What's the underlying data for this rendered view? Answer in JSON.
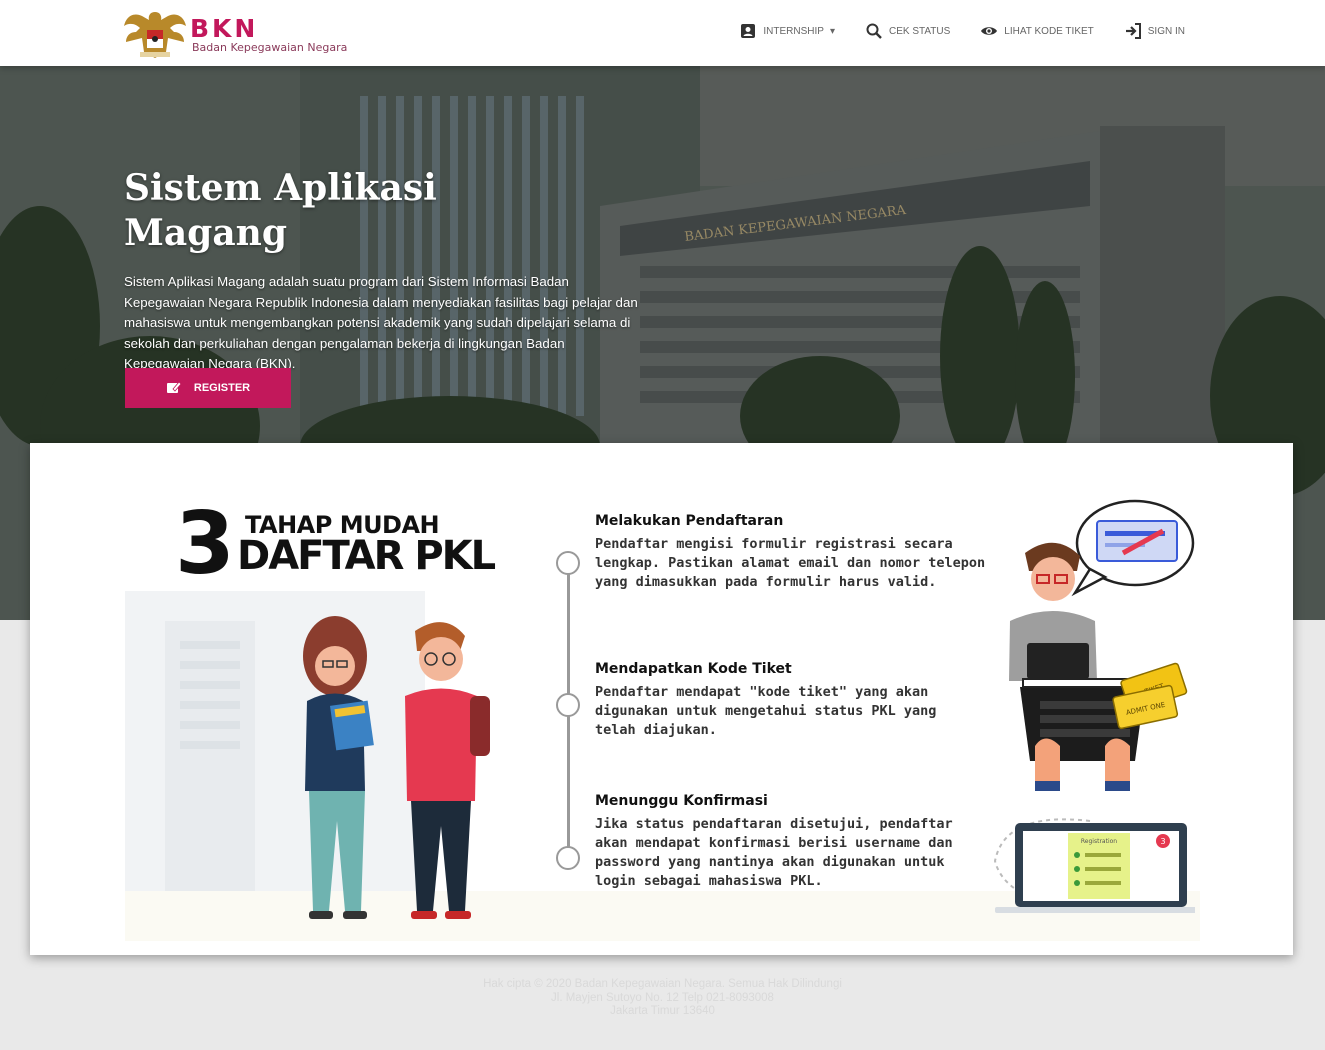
{
  "brand": {
    "name": "BKN",
    "subtitle": "Badan Kepegawaian Negara"
  },
  "nav": {
    "items": [
      {
        "label": "INTERNSHIP",
        "icon": "id-card-icon",
        "dropdown": true
      },
      {
        "label": "CEK STATUS",
        "icon": "search-icon"
      },
      {
        "label": "LIHAT KODE TIKET",
        "icon": "eye-icon"
      },
      {
        "label": "SIGN IN",
        "icon": "sign-in-icon"
      }
    ]
  },
  "hero": {
    "title_line1": "Sistem Aplikasi",
    "title_line2": "Magang",
    "description": "Sistem Aplikasi Magang adalah suatu program dari Sistem Informasi Badan Kepegawaian Negara Republik Indonesia dalam menyediakan fasilitas bagi pelajar dan mahasiswa untuk mengembangkan potensi akademik yang sudah dipelajari selama di sekolah dan perkuliahan dengan pengalaman bekerja di lingkungan Badan Kepegawaian Negara (BKN).",
    "building_sign": "BADAN KEPEGAWAIAN NEGARA",
    "register_label": "REGISTER"
  },
  "infographic": {
    "number": "3",
    "line1": "TAHAP MUDAH",
    "line2": "DAFTAR PKL",
    "steps": [
      {
        "title": "Melakukan Pendaftaran",
        "text": "Pendaftar mengisi formulir registrasi secara lengkap. Pastikan alamat email dan nomor telepon yang dimasukkan pada formulir harus valid."
      },
      {
        "title": "Mendapatkan Kode Tiket",
        "text": "Pendaftar mendapat \"kode tiket\" yang akan digunakan untuk mengetahui status PKL yang telah diajukan."
      },
      {
        "title": "Menunggu  Konfirmasi",
        "text": "Jika status pendaftaran disetujui, pendaftar akan mendapat konfirmasi berisi username dan password yang nantinya akan digunakan untuk login sebagai mahasiswa PKL."
      }
    ],
    "ticket_text": "ADMIT ONE",
    "ticket_text2": "TIKET",
    "laptop_badge": "3",
    "laptop_doc_title": "Registration"
  },
  "footer": {
    "line1": "Hak cipta © 2020 Badan Kepegawaian Negara. Semua Hak Dilindungi",
    "line2": "Jl. Mayjen Sutoyo No. 12 Telp 021-8093008",
    "line3": "Jakarta Timur 13640"
  },
  "colors": {
    "accent": "#c2185b",
    "nav_bg": "#ffffff",
    "page_bg": "#e9e9e9"
  }
}
